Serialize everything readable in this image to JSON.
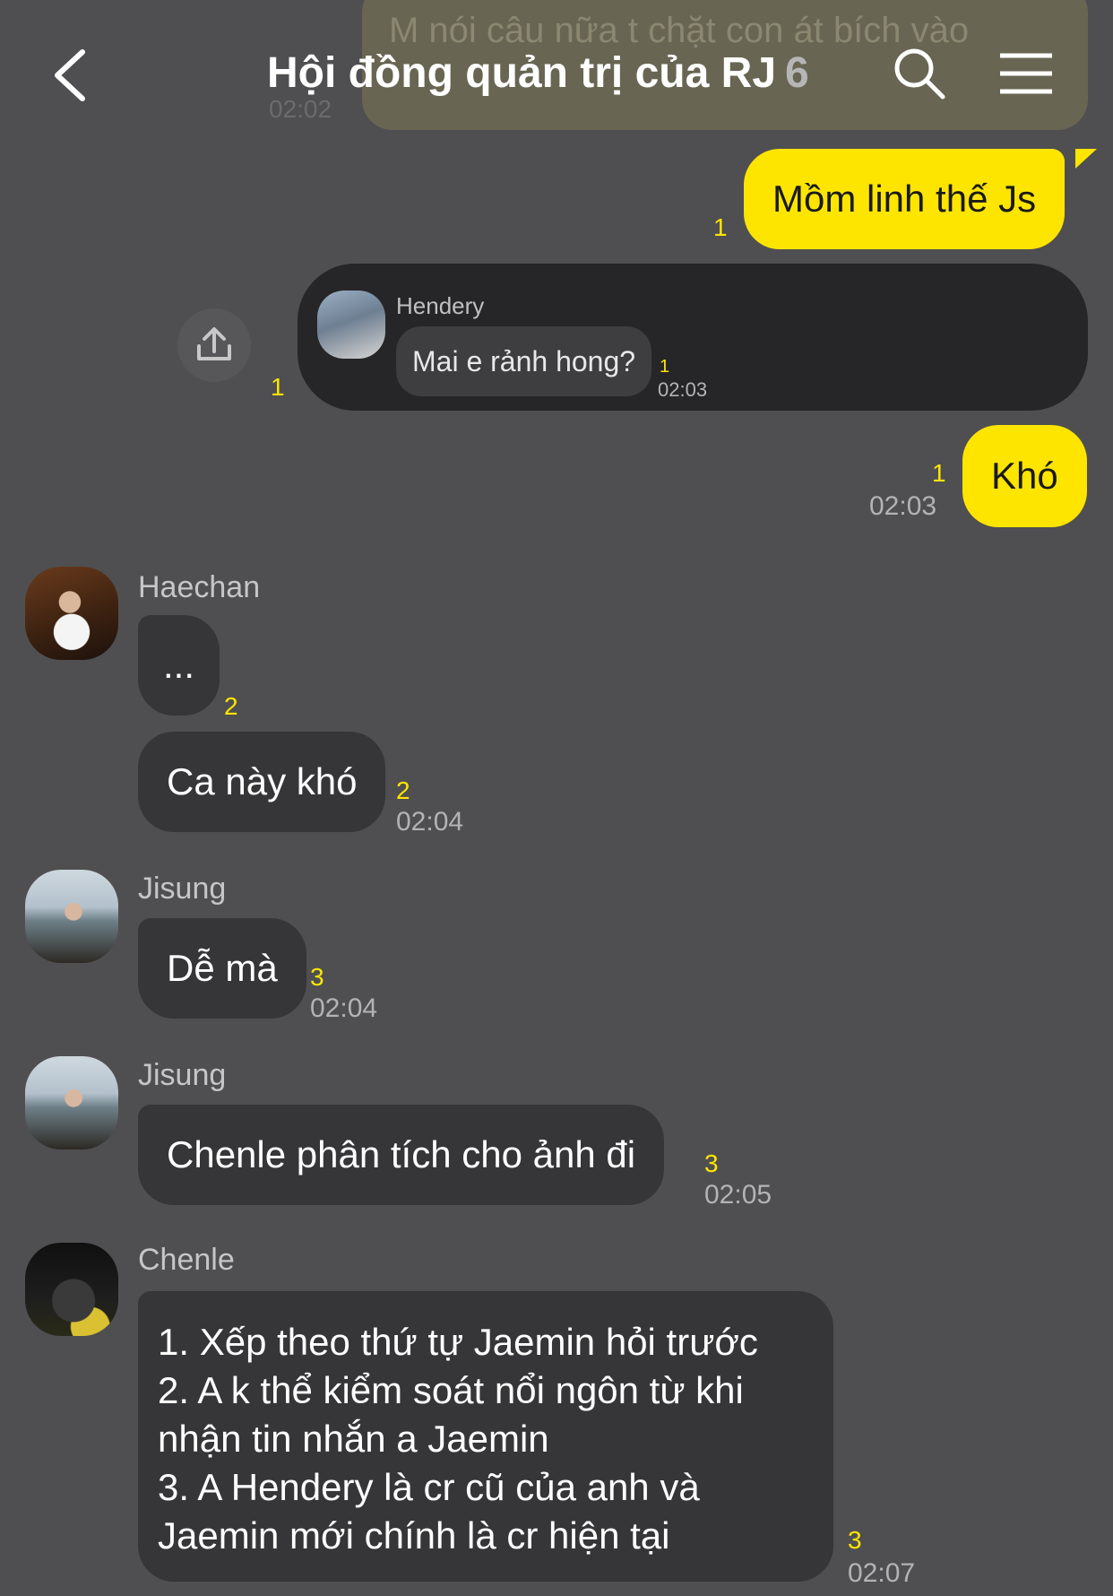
{
  "header": {
    "title": "Hội đồng quản trị của RJ",
    "member_count": "6"
  },
  "ghost": {
    "text": "M nói câu nữa t chặt con át bích vào",
    "time": "02:02"
  },
  "messages": {
    "m1": {
      "text": "Mồm linh thế Js",
      "unread": "1"
    },
    "shared": {
      "sender": "Hendery",
      "text": "Mai e rảnh hong?",
      "unread_inner": "1",
      "time_inner": "02:03",
      "unread": "1"
    },
    "m2": {
      "text": "Khó",
      "unread": "1",
      "time": "02:03"
    },
    "haechan": {
      "name": "Haechan",
      "b1": {
        "text": "...",
        "unread": "2"
      },
      "b2": {
        "text": "Ca này khó",
        "unread": "2",
        "time": "02:04"
      }
    },
    "jisung1": {
      "name": "Jisung",
      "b1": {
        "text": "Dễ mà",
        "unread": "3",
        "time": "02:04"
      }
    },
    "jisung2": {
      "name": "Jisung",
      "b1": {
        "text": "Chenle phân tích cho ảnh đi",
        "unread": "3",
        "time": "02:05"
      }
    },
    "chenle": {
      "name": "Chenle",
      "lines": [
        "1. Xếp theo thứ tự Jaemin hỏi trước",
        "2. A k thể kiểm soát nổi ngôn từ khi",
        "nhận tin nhắn a Jaemin",
        "3. A Hendery là cr cũ của anh và",
        "Jaemin mới chính là cr hiện tại"
      ],
      "unread": "3",
      "time": "02:07"
    }
  },
  "colors": {
    "background": "#4f4f51",
    "my_bubble": "#fde500",
    "other_bubble": "#363638",
    "unread": "#fde500"
  }
}
